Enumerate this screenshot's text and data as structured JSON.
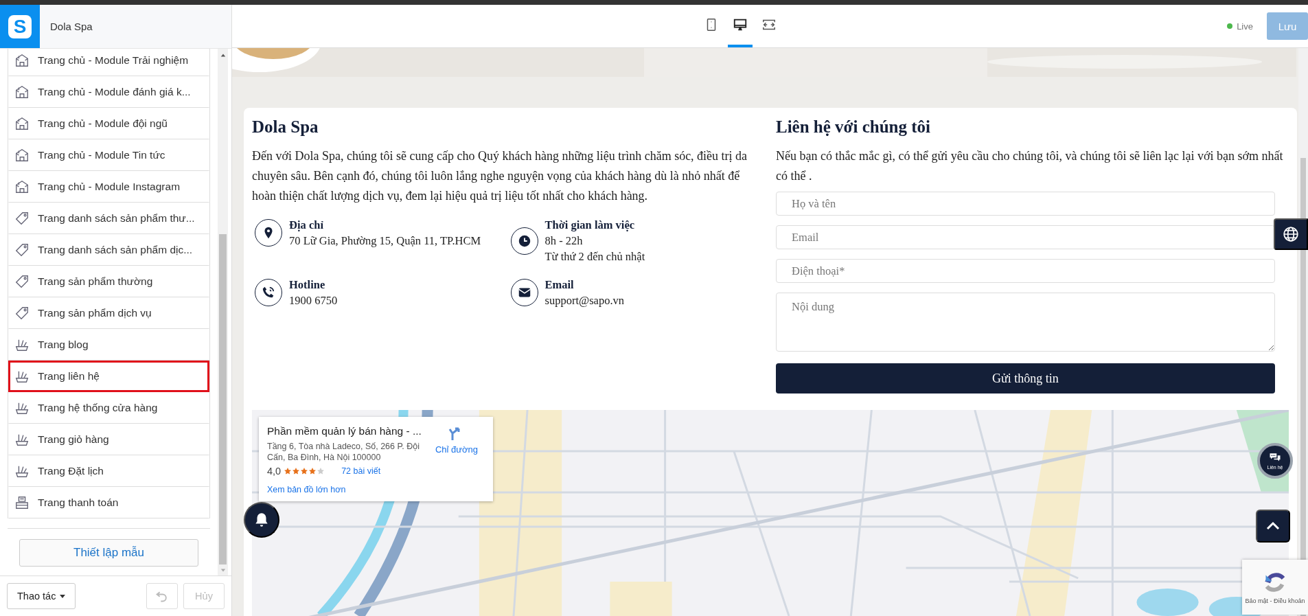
{
  "app": {
    "logo": "S",
    "store_name": "Dola Spa"
  },
  "toolbar": {
    "devices": [
      {
        "kind": "mobile",
        "selected": false
      },
      {
        "kind": "desktop",
        "selected": true
      },
      {
        "kind": "fullwidth",
        "selected": false
      }
    ],
    "status": {
      "label": "Live",
      "online": true
    },
    "save_button": {
      "label": "Lưu",
      "disabled": true
    }
  },
  "sidebar": {
    "items": [
      {
        "label": "Trang chủ - Module Trải nghiệm",
        "kind": "home",
        "selected": false
      },
      {
        "label": "Trang chủ - Module đánh giá k...",
        "kind": "home",
        "selected": false
      },
      {
        "label": "Trang chủ - Module đội ngũ",
        "kind": "home",
        "selected": false
      },
      {
        "label": "Trang chủ - Module Tin tức",
        "kind": "home",
        "selected": false
      },
      {
        "label": "Trang chủ - Module Instagram",
        "kind": "home",
        "selected": false
      },
      {
        "label": "Trang danh sách sản phẩm thư...",
        "kind": "tag",
        "selected": false
      },
      {
        "label": "Trang danh sách sản phẩm dịc...",
        "kind": "tag",
        "selected": false
      },
      {
        "label": "Trang sản phẩm thường",
        "kind": "tag",
        "selected": false
      },
      {
        "label": "Trang sản phẩm dịch vụ",
        "kind": "tag",
        "selected": false
      },
      {
        "label": "Trang blog",
        "kind": "brush",
        "selected": false
      },
      {
        "label": "Trang liên hệ",
        "kind": "brush",
        "selected": true
      },
      {
        "label": "Trang hệ thống cửa hàng",
        "kind": "brush",
        "selected": false
      },
      {
        "label": "Trang giỏ hàng",
        "kind": "brush",
        "selected": false
      },
      {
        "label": "Trang Đặt lịch",
        "kind": "brush",
        "selected": false
      },
      {
        "label": "Trang thanh toán",
        "kind": "register",
        "selected": false
      }
    ],
    "template_button": "Thiết lập mẫu",
    "actions_button": "Thao tác",
    "undo_button": {
      "disabled": true
    },
    "cancel_button": {
      "label": "Hủy",
      "disabled": true
    }
  },
  "preview": {
    "about": {
      "title": "Dola Spa",
      "text": "Đến với Dola Spa, chúng tôi sẽ cung cấp cho Quý khách hàng những liệu trình chăm sóc, điều trị da chuyên sâu. Bên cạnh đó, chúng tôi luôn lắng nghe nguyện vọng của khách hàng dù là nhỏ nhất để hoàn thiện chất lượng dịch vụ, đem lại hiệu quả trị liệu tốt nhất cho khách hàng.",
      "contacts": [
        {
          "kind": "address",
          "label": "Địa chỉ",
          "lines": [
            "70 Lữ Gia, Phường 15, Quận 11, TP.HCM"
          ]
        },
        {
          "kind": "hours",
          "label": "Thời gian làm việc",
          "lines": [
            "8h - 22h",
            "Từ thứ 2 đến chủ nhật"
          ]
        },
        {
          "kind": "phone",
          "label": "Hotline",
          "lines": [
            "1900 6750"
          ]
        },
        {
          "kind": "email",
          "label": "Email",
          "lines": [
            "support@sapo.vn"
          ]
        }
      ]
    },
    "contact_form": {
      "title": "Liên hệ với chúng tôi",
      "text": "Nếu bạn có thắc mắc gì, có thể gửi yêu cầu cho chúng tôi, và chúng tôi sẽ liên lạc lại với bạn sớm nhất có thể .",
      "fields": [
        {
          "kind": "input",
          "placeholder": "Họ và tên"
        },
        {
          "kind": "input",
          "placeholder": "Email"
        },
        {
          "kind": "input",
          "placeholder": "Điện thoại*"
        },
        {
          "kind": "textarea",
          "placeholder": "Nội dung"
        }
      ],
      "submit": "Gửi thông tin"
    },
    "map": {
      "card": {
        "title": "Phần mềm quản lý bán hàng - ...",
        "address": "Tầng 6, Tòa nhà Ladeco, Số, 266 P. Đội Cấn, Ba Đình, Hà Nội 100000",
        "rating": "4,0",
        "stars": 4,
        "reviews": "72 bài viết",
        "directions": "Chỉ đường",
        "larger_map": "Xem bản đồ lớn hơn"
      }
    },
    "chat_button": {
      "label": "Liên hệ"
    },
    "recaptcha": {
      "text": "Bảo mật - Điều khoản"
    }
  }
}
